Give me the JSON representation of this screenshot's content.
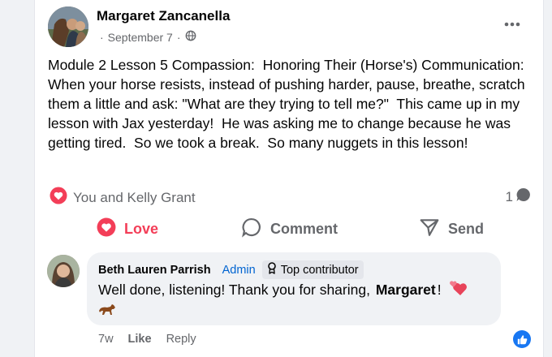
{
  "post": {
    "author": "Margaret Zancanella",
    "date": "September 7",
    "separator": "·",
    "audience_icon": "globe-icon",
    "body": "Module 2 Lesson 5 Compassion:  Honoring Their (Horse's) Communication: When your horse resists, instead of pushing harder, pause, breathe, scratch them a little and ask: \"What are they trying to tell me?\"  This came up in my lesson with Jax yesterday!  He was asking me to change because he was getting tired.  So we took a break.  So many nuggets in this lesson!",
    "reactions_text": "You and Kelly Grant",
    "comment_count": "1"
  },
  "actions": {
    "love_label": "Love",
    "comment_label": "Comment",
    "send_label": "Send"
  },
  "comment": {
    "author": "Beth Lauren Parrish",
    "role": "Admin",
    "badge": "Top contributor",
    "text_before": "Well done, listening! Thank you for sharing, ",
    "mention": "Margaret",
    "text_after": "!",
    "time": "7w",
    "like_label": "Like",
    "reply_label": "Reply"
  },
  "colors": {
    "love": "#f33e58",
    "link": "#0064d1",
    "muted": "#65676b",
    "like_blue": "#1877f2"
  }
}
